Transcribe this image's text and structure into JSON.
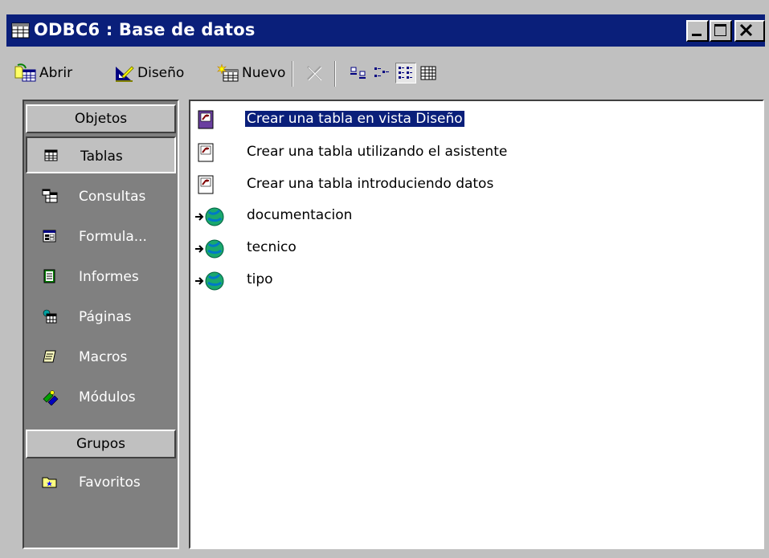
{
  "window": {
    "title": "ODBC6 : Base de datos",
    "controls": [
      "minimize",
      "maximize",
      "close"
    ]
  },
  "toolbar": {
    "open_label": "Abrir",
    "design_label": "Diseño",
    "new_label": "Nuevo",
    "view_modes": [
      "large-icons",
      "small-icons",
      "list",
      "details"
    ],
    "active_view": "list"
  },
  "sidebar": {
    "objects_header": "Objetos",
    "groups_header": "Grupos",
    "items": [
      {
        "label": "Tablas",
        "icon": "table-icon",
        "selected": true
      },
      {
        "label": "Consultas",
        "icon": "query-icon",
        "selected": false
      },
      {
        "label": "Formula...",
        "icon": "form-icon",
        "selected": false
      },
      {
        "label": "Informes",
        "icon": "report-icon",
        "selected": false
      },
      {
        "label": "Páginas",
        "icon": "page-icon",
        "selected": false
      },
      {
        "label": "Macros",
        "icon": "macro-icon",
        "selected": false
      },
      {
        "label": "Módulos",
        "icon": "module-icon",
        "selected": false
      }
    ],
    "groups": [
      {
        "label": "Favoritos",
        "icon": "favorites-folder-icon"
      }
    ]
  },
  "main": {
    "items": [
      {
        "label": "Crear una tabla en vista Diseño",
        "icon": "shortcut-icon",
        "selected": true
      },
      {
        "label": "Crear una tabla utilizando el asistente",
        "icon": "shortcut-icon",
        "selected": false
      },
      {
        "label": "Crear una tabla introduciendo datos",
        "icon": "shortcut-icon",
        "selected": false
      },
      {
        "label": "documentacion",
        "icon": "linked-table-globe-icon",
        "selected": false
      },
      {
        "label": "tecnico",
        "icon": "linked-table-globe-icon",
        "selected": false
      },
      {
        "label": "tipo",
        "icon": "linked-table-globe-icon",
        "selected": false
      }
    ]
  },
  "colors": {
    "title_bar": "#0a1f7a",
    "chrome": "#c0c0c0",
    "sidebar_bg": "#808080",
    "selection": "#0a1f7a"
  }
}
